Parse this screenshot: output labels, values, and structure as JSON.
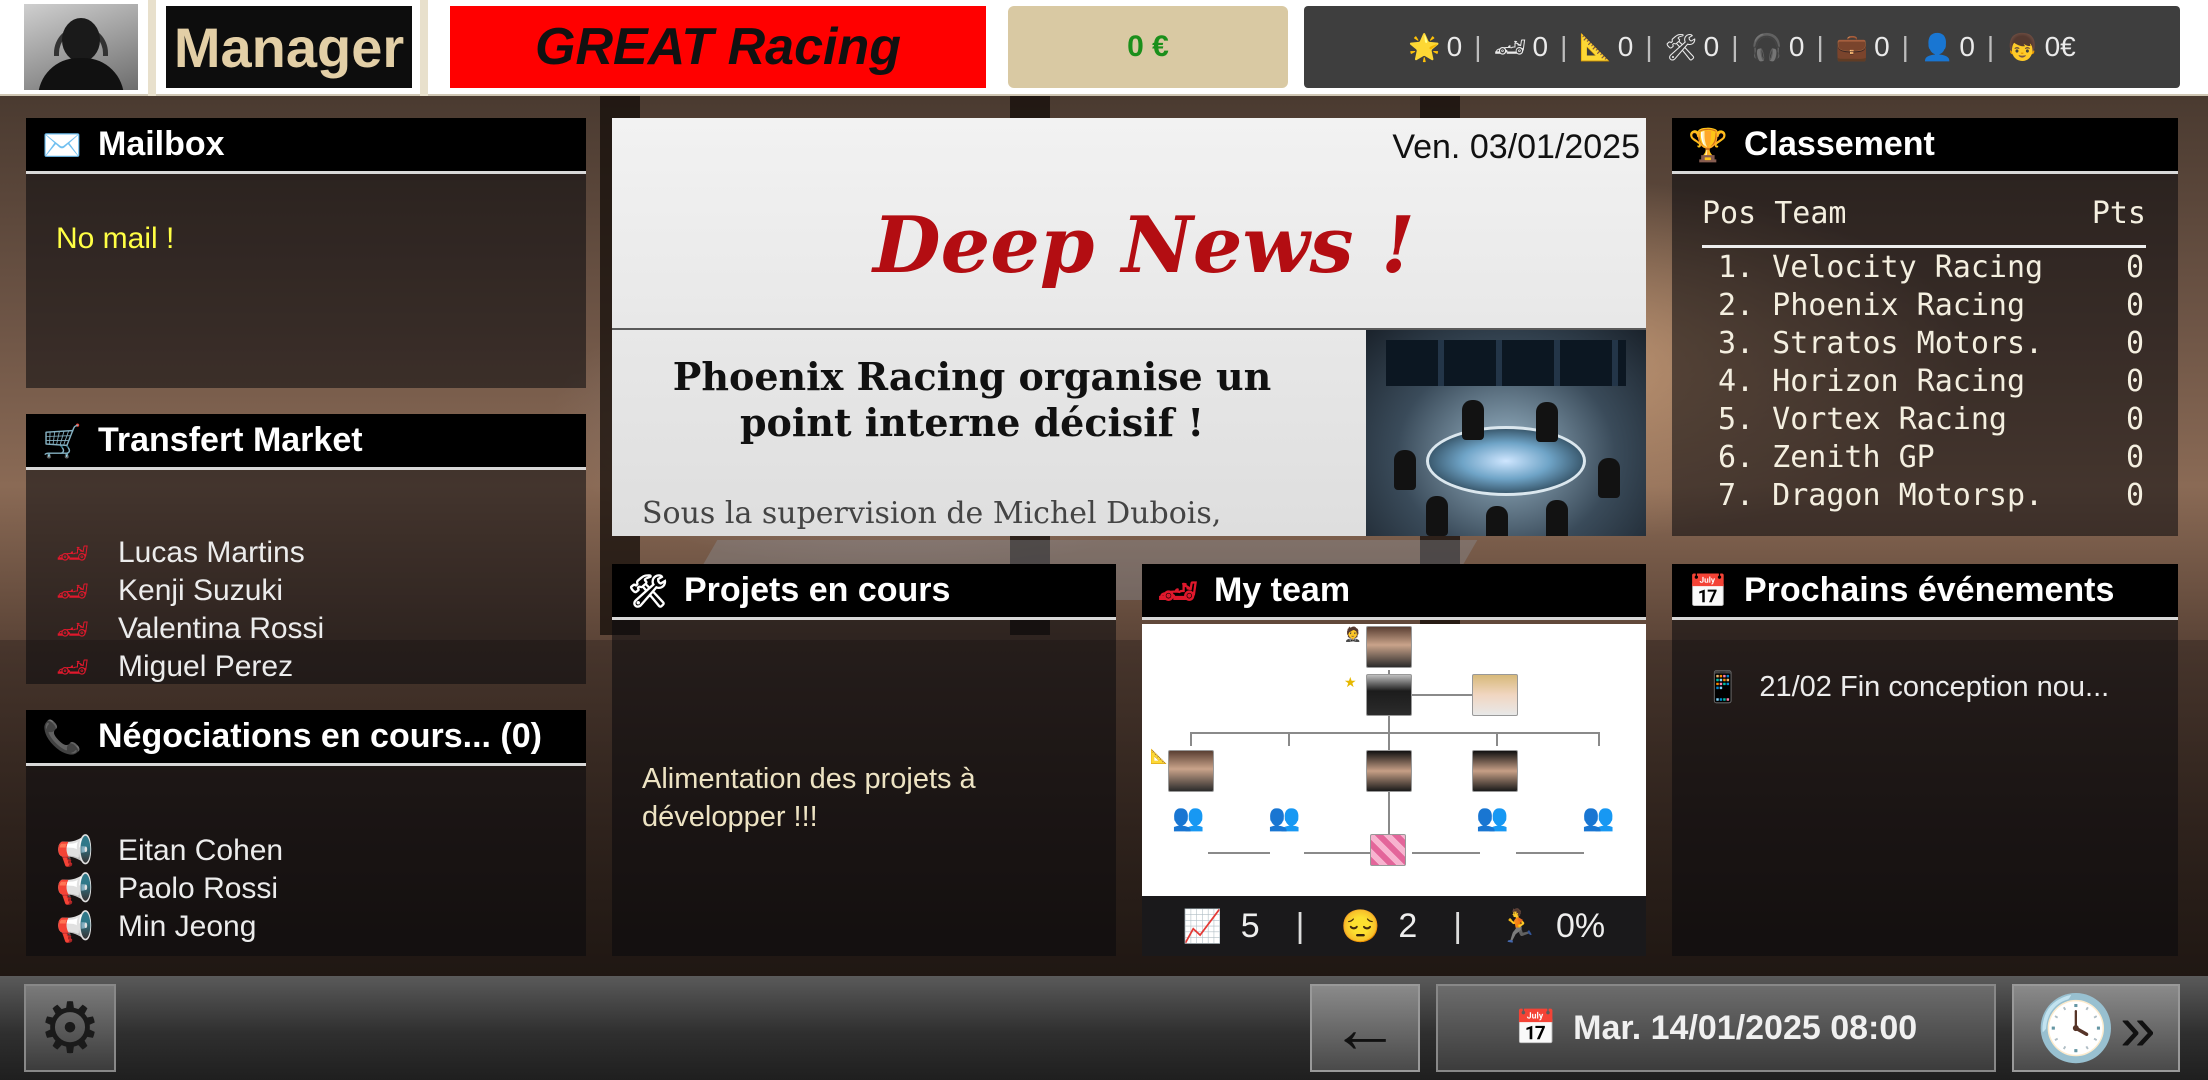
{
  "header": {
    "role": "Manager",
    "team_name": "GREAT Racing",
    "money": "0 €",
    "stats": [
      {
        "icon": "star-icon",
        "glyph": "🌟",
        "value": "0"
      },
      {
        "icon": "race-car-icon",
        "glyph": "🏎",
        "value": "0"
      },
      {
        "icon": "set-square-icon",
        "glyph": "📐",
        "value": "0"
      },
      {
        "icon": "tools-icon",
        "glyph": "🛠",
        "value": "0"
      },
      {
        "icon": "headset-icon",
        "glyph": "🎧",
        "value": "0"
      },
      {
        "icon": "briefcase-icon",
        "glyph": "💼",
        "value": "0"
      },
      {
        "icon": "person-icon",
        "glyph": "👤",
        "value": "0"
      },
      {
        "icon": "staff-icon",
        "glyph": "👦",
        "value": "0€"
      }
    ]
  },
  "mailbox": {
    "title": "Mailbox",
    "empty_text": "No mail !"
  },
  "market": {
    "title": "Transfert Market",
    "items": [
      "Lucas Martins",
      "Kenji Suzuki",
      "Valentina Rossi",
      "Miguel Perez"
    ]
  },
  "negotiations": {
    "title": "Négociations en cours... (0)",
    "items": [
      "Eitan Cohen",
      "Paolo Rossi",
      "Min Jeong"
    ]
  },
  "news": {
    "date": "Ven. 03/01/2025",
    "masthead": "Deep News !",
    "headline": "Phoenix Racing organise un point interne décisif !",
    "lede": "Sous la supervision de Michel  Dubois,"
  },
  "projects": {
    "title": "Projets en cours",
    "text": "Alimentation des projets à développer !!!"
  },
  "my_team": {
    "title": "My team",
    "performance": "5",
    "mood": "2",
    "progress": "0%"
  },
  "ranking": {
    "title": "Classement",
    "col_pos_team": "Pos Team",
    "col_pts": "Pts",
    "rows": [
      {
        "rank": "1. Velocity Racing",
        "pts": "0"
      },
      {
        "rank": "2. Phoenix Racing",
        "pts": "0"
      },
      {
        "rank": "3. Stratos Motors.",
        "pts": "0"
      },
      {
        "rank": "4. Horizon Racing",
        "pts": "0"
      },
      {
        "rank": "5. Vortex Racing",
        "pts": "0"
      },
      {
        "rank": "6. Zenith GP",
        "pts": "0"
      },
      {
        "rank": "7. Dragon Motorsp.",
        "pts": "0"
      }
    ]
  },
  "events": {
    "title": "Prochains événements",
    "items": [
      "21/02 Fin conception nou..."
    ]
  },
  "footer": {
    "current_datetime": "Mar. 14/01/2025 08:00"
  }
}
